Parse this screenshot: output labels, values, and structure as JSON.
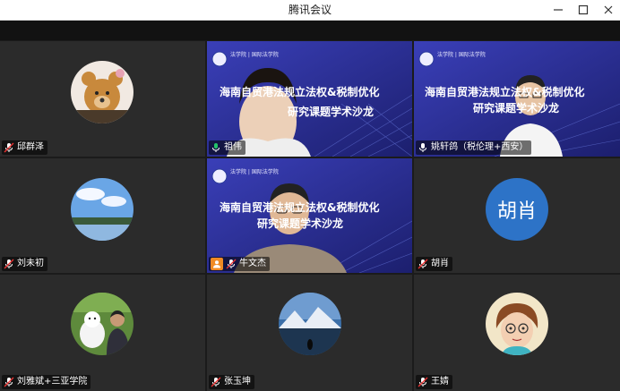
{
  "window": {
    "title": "腾讯会议"
  },
  "slide": {
    "header_text": "法学院 | 国际法学院",
    "title": "海南自贸港法规立法权&税制优化",
    "subtitle": "研究课题学术沙龙"
  },
  "participants": [
    {
      "name": "邱群泽",
      "avatar": "teddy-bear"
    },
    {
      "name": "祖伟",
      "avatar": "video"
    },
    {
      "name": "姚轩鸽（税伦理+西安）",
      "avatar": "video"
    },
    {
      "name": "刘未初",
      "avatar": "sky-lake"
    },
    {
      "name": "牛文杰",
      "avatar": "video"
    },
    {
      "name": "胡肖",
      "avatar": "text",
      "avatar_text": "胡肖"
    },
    {
      "name": "刘雅斌+三亚学院",
      "avatar": "man-with-dog"
    },
    {
      "name": "张玉坤",
      "avatar": "mountain-lake"
    },
    {
      "name": "王婧",
      "avatar": "cartoon-girl"
    }
  ],
  "colors": {
    "active_speaker": "#23c36a",
    "text_avatar_bg": "#2d73c7",
    "host_badge": "#f08a24"
  }
}
